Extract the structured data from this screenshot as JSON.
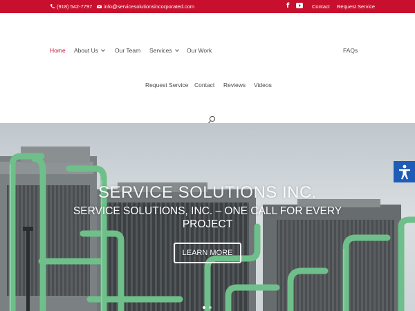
{
  "topbar": {
    "phone": "(918) 542-7797",
    "email": "info@servicesolutionsincorporated.com",
    "social": [
      "facebook-icon",
      "youtube-icon"
    ],
    "links": {
      "contact": "Contact",
      "request_service": "Request Service"
    }
  },
  "nav": {
    "row1": {
      "home": "Home",
      "about_us": "About Us",
      "our_team": "Our Team",
      "services": "Services",
      "our_work": "Our Work",
      "faqs": "FAQs"
    },
    "row2": {
      "request_service": "Request Service",
      "contact": "Contact",
      "reviews": "Reviews",
      "videos": "Videos"
    },
    "active": "Home"
  },
  "hero": {
    "title": "SERVICE SOLUTIONS INC.",
    "subtitle": "SERVICE SOLUTIONS, INC. – ONE CALL FOR EVERY PROJECT",
    "button": "LEARN MORE",
    "slides": 2,
    "current_slide": 1
  },
  "colors": {
    "brand_red": "#c8102e",
    "pipe_green": "#6fbf8a",
    "a11y_blue": "#1e5cb8"
  }
}
